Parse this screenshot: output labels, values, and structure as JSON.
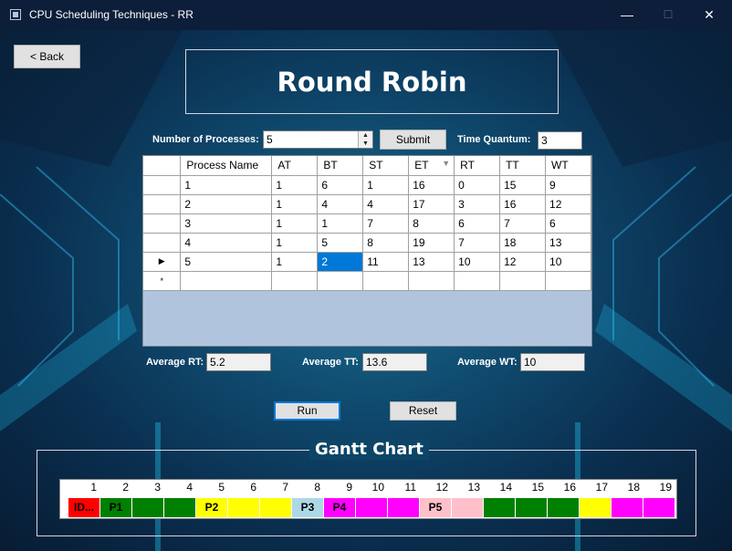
{
  "window": {
    "title": "CPU Scheduling Techniques - RR",
    "minimize": "—",
    "maximize": "☐",
    "close": "✕"
  },
  "back_button": "< Back",
  "heading": "Round Robin",
  "controls": {
    "num_processes_label": "Number of Processes:",
    "num_processes_value": "5",
    "submit_label": "Submit",
    "time_quantum_label": "Time Quantum:",
    "time_quantum_value": "3"
  },
  "table": {
    "columns": [
      "Process Name",
      "AT",
      "BT",
      "ST",
      "ET",
      "RT",
      "TT",
      "WT"
    ],
    "sorted_column": "ET",
    "rows": [
      [
        "1",
        "1",
        "6",
        "1",
        "16",
        "0",
        "15",
        "9"
      ],
      [
        "2",
        "1",
        "4",
        "4",
        "17",
        "3",
        "16",
        "12"
      ],
      [
        "3",
        "1",
        "1",
        "7",
        "8",
        "6",
        "7",
        "6"
      ],
      [
        "4",
        "1",
        "5",
        "8",
        "19",
        "7",
        "18",
        "13"
      ],
      [
        "5",
        "1",
        "2",
        "11",
        "13",
        "10",
        "12",
        "10"
      ]
    ],
    "current_row_marker": "▶",
    "new_row_marker": "*"
  },
  "averages": {
    "rt_label": "Average RT:",
    "rt_value": "5.2",
    "tt_label": "Average TT:",
    "tt_value": "13.6",
    "wt_label": "Average WT:",
    "wt_value": "10"
  },
  "run_label": "Run",
  "reset_label": "Reset",
  "gantt": {
    "title": "Gantt Chart",
    "numbers": [
      "1",
      "2",
      "3",
      "4",
      "5",
      "6",
      "7",
      "8",
      "9",
      "10",
      "11",
      "12",
      "13",
      "14",
      "15",
      "16",
      "17",
      "18",
      "19"
    ],
    "cells": [
      {
        "label": "ID...",
        "color": "#ff0000"
      },
      {
        "label": "P1",
        "color": "#008000"
      },
      {
        "label": "",
        "color": "#008000"
      },
      {
        "label": "",
        "color": "#008000"
      },
      {
        "label": "P2",
        "color": "#ffff00"
      },
      {
        "label": "",
        "color": "#ffff00"
      },
      {
        "label": "",
        "color": "#ffff00"
      },
      {
        "label": "P3",
        "color": "#add8e6"
      },
      {
        "label": "P4",
        "color": "#ff00ff"
      },
      {
        "label": "",
        "color": "#ff00ff"
      },
      {
        "label": "",
        "color": "#ff00ff"
      },
      {
        "label": "P5",
        "color": "#ffc0cb"
      },
      {
        "label": "",
        "color": "#ffc0cb"
      },
      {
        "label": "",
        "color": "#008000"
      },
      {
        "label": "",
        "color": "#008000"
      },
      {
        "label": "",
        "color": "#008000"
      },
      {
        "label": "",
        "color": "#ffff00"
      },
      {
        "label": "",
        "color": "#ff00ff"
      },
      {
        "label": "",
        "color": "#ff00ff"
      }
    ]
  }
}
